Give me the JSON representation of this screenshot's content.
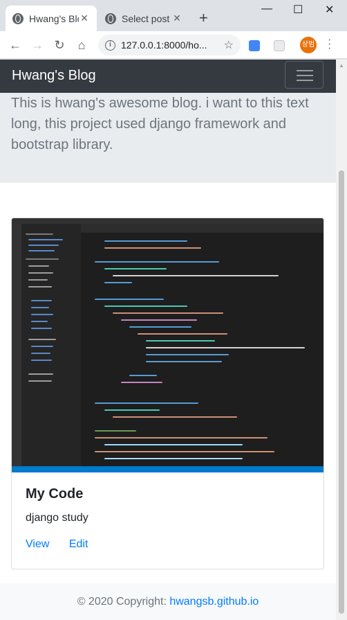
{
  "browser": {
    "tabs": [
      {
        "title": "Hwang's Blog",
        "active": true
      },
      {
        "title": "Select post t",
        "active": false
      }
    ],
    "address": "127.0.0.1:8000/ho...",
    "profile_initials": "상범"
  },
  "navbar": {
    "brand": "Hwang's Blog"
  },
  "jumbotron": {
    "lead": "This is hwang's awesome blog. i want to this text long, this project used django framework and bootstrap library."
  },
  "card": {
    "title": "My Code",
    "text": "django study",
    "links": {
      "view": "View",
      "edit": "Edit"
    }
  },
  "footer": {
    "prefix": "© 2020 Copyright: ",
    "link": "hwangsb.github.io"
  },
  "colors": {
    "navbar": "#343a40",
    "link": "#007bff",
    "jumbotron": "#e9ecef"
  }
}
